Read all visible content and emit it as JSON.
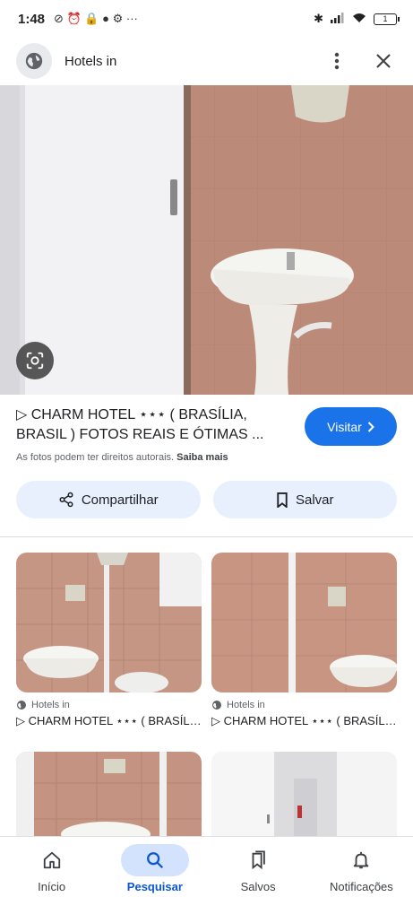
{
  "status_bar": {
    "time": "1:48",
    "notif_icons": "⊘ ⏰ 🔒 ● ⚙ ···",
    "battery": "1"
  },
  "header": {
    "title": "Hotels in"
  },
  "result": {
    "title": "▷ CHARM HOTEL ⋆⋆⋆ ( BRASÍLIA, BRASIL ) FOTOS REAIS E ÓTIMAS ...",
    "copyright": "As fotos podem ter direitos autorais.",
    "learn_more": "Saiba mais",
    "visit_label": "Visitar"
  },
  "actions": {
    "share_label": "Compartilhar",
    "save_label": "Salvar"
  },
  "related": [
    {
      "source": "Hotels in",
      "title": "▷ CHARM HOTEL ⋆⋆⋆ ( BRASÍLIA, BRASIL ) FOTOS"
    },
    {
      "source": "Hotels in",
      "title": "▷ CHARM HOTEL ⋆⋆⋆ ( BRASÍLIA, BRASIL ) FOTOS"
    },
    {
      "source": "",
      "title": ""
    },
    {
      "source": "",
      "title": ""
    }
  ],
  "bottom_nav": [
    {
      "label": "Início",
      "icon": "home-icon"
    },
    {
      "label": "Pesquisar",
      "icon": "search-icon",
      "active": true
    },
    {
      "label": "Salvos",
      "icon": "saved-icon"
    },
    {
      "label": "Notificações",
      "icon": "bell-icon"
    }
  ],
  "colors": {
    "accent": "#1a73e8",
    "pill_bg": "#e8f0fe",
    "active_nav": "#d3e3fd"
  }
}
